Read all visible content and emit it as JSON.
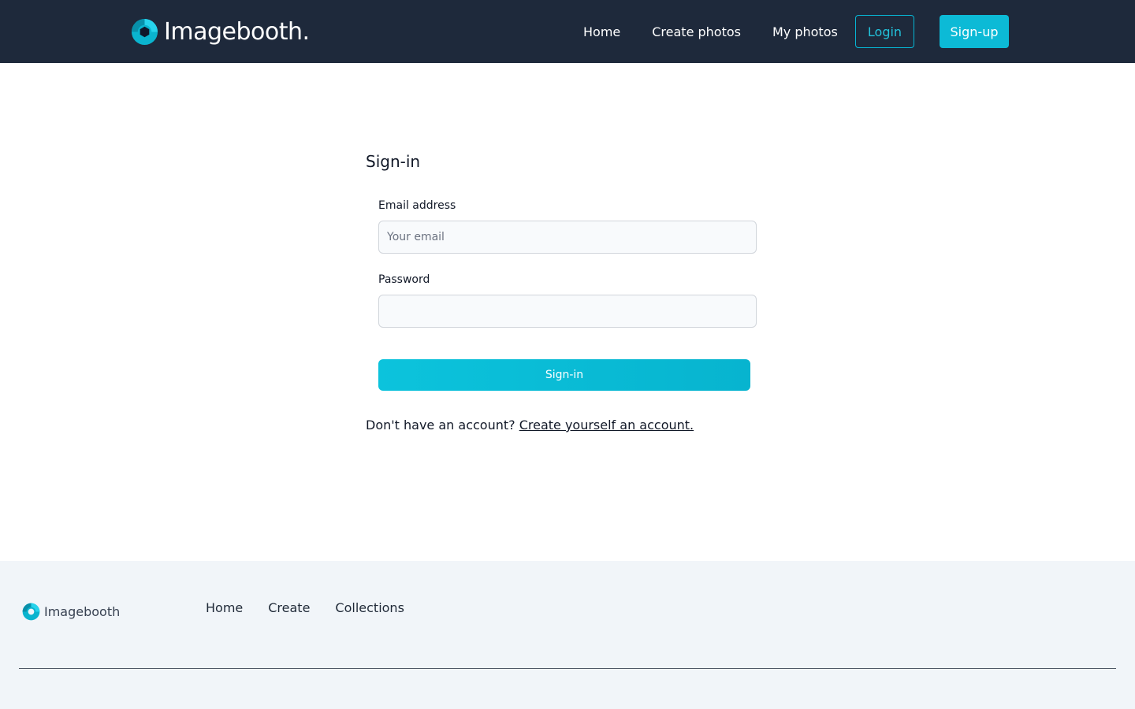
{
  "colors": {
    "header_bg": "#1e293b",
    "accent": "#0cbad6",
    "footer_bg": "#f1f5f9"
  },
  "header": {
    "brand": "Imagebooth.",
    "logo_icon": "aperture-logo-icon",
    "nav": [
      {
        "label": "Home"
      },
      {
        "label": "Create photos"
      },
      {
        "label": "My photos"
      }
    ],
    "login_label": "Login",
    "signup_label": "Sign-up"
  },
  "form": {
    "title": "Sign-in",
    "email": {
      "label": "Email address",
      "placeholder": "Your email",
      "value": ""
    },
    "password": {
      "label": "Password",
      "placeholder": "",
      "value": ""
    },
    "submit_label": "Sign-in",
    "prompt_text": "Don't have an account? ",
    "prompt_link": "Create yourself an account."
  },
  "footer": {
    "brand": "Imagebooth",
    "logo_icon": "aperture-logo-icon",
    "nav": [
      {
        "label": "Home"
      },
      {
        "label": "Create"
      },
      {
        "label": "Collections"
      }
    ]
  }
}
